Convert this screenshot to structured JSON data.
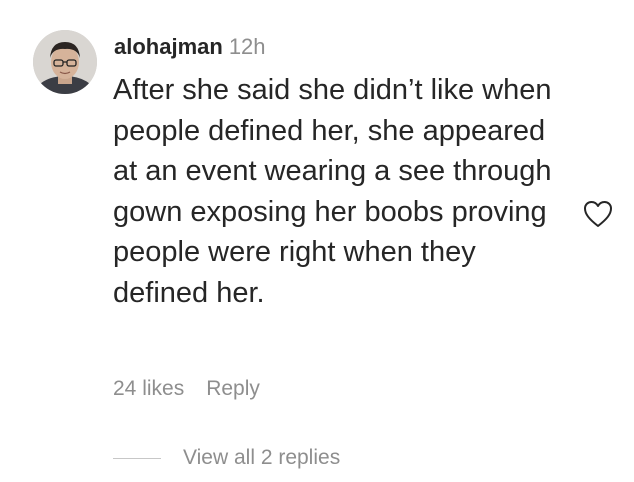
{
  "comment": {
    "username": "alohajman",
    "timestamp": "12h",
    "text": "After she said she didn’t like when people defined her, she appeared at an event wearing a see through gown exposing her boobs proving people were right when they defined her.",
    "likes": "24 likes",
    "reply_label": "Reply",
    "view_replies_label": "View all 2 replies",
    "like_icon": "heart-outline-icon"
  },
  "colors": {
    "text_primary": "#262626",
    "text_secondary": "#8e8e8e",
    "divider": "#c7c7c7"
  }
}
